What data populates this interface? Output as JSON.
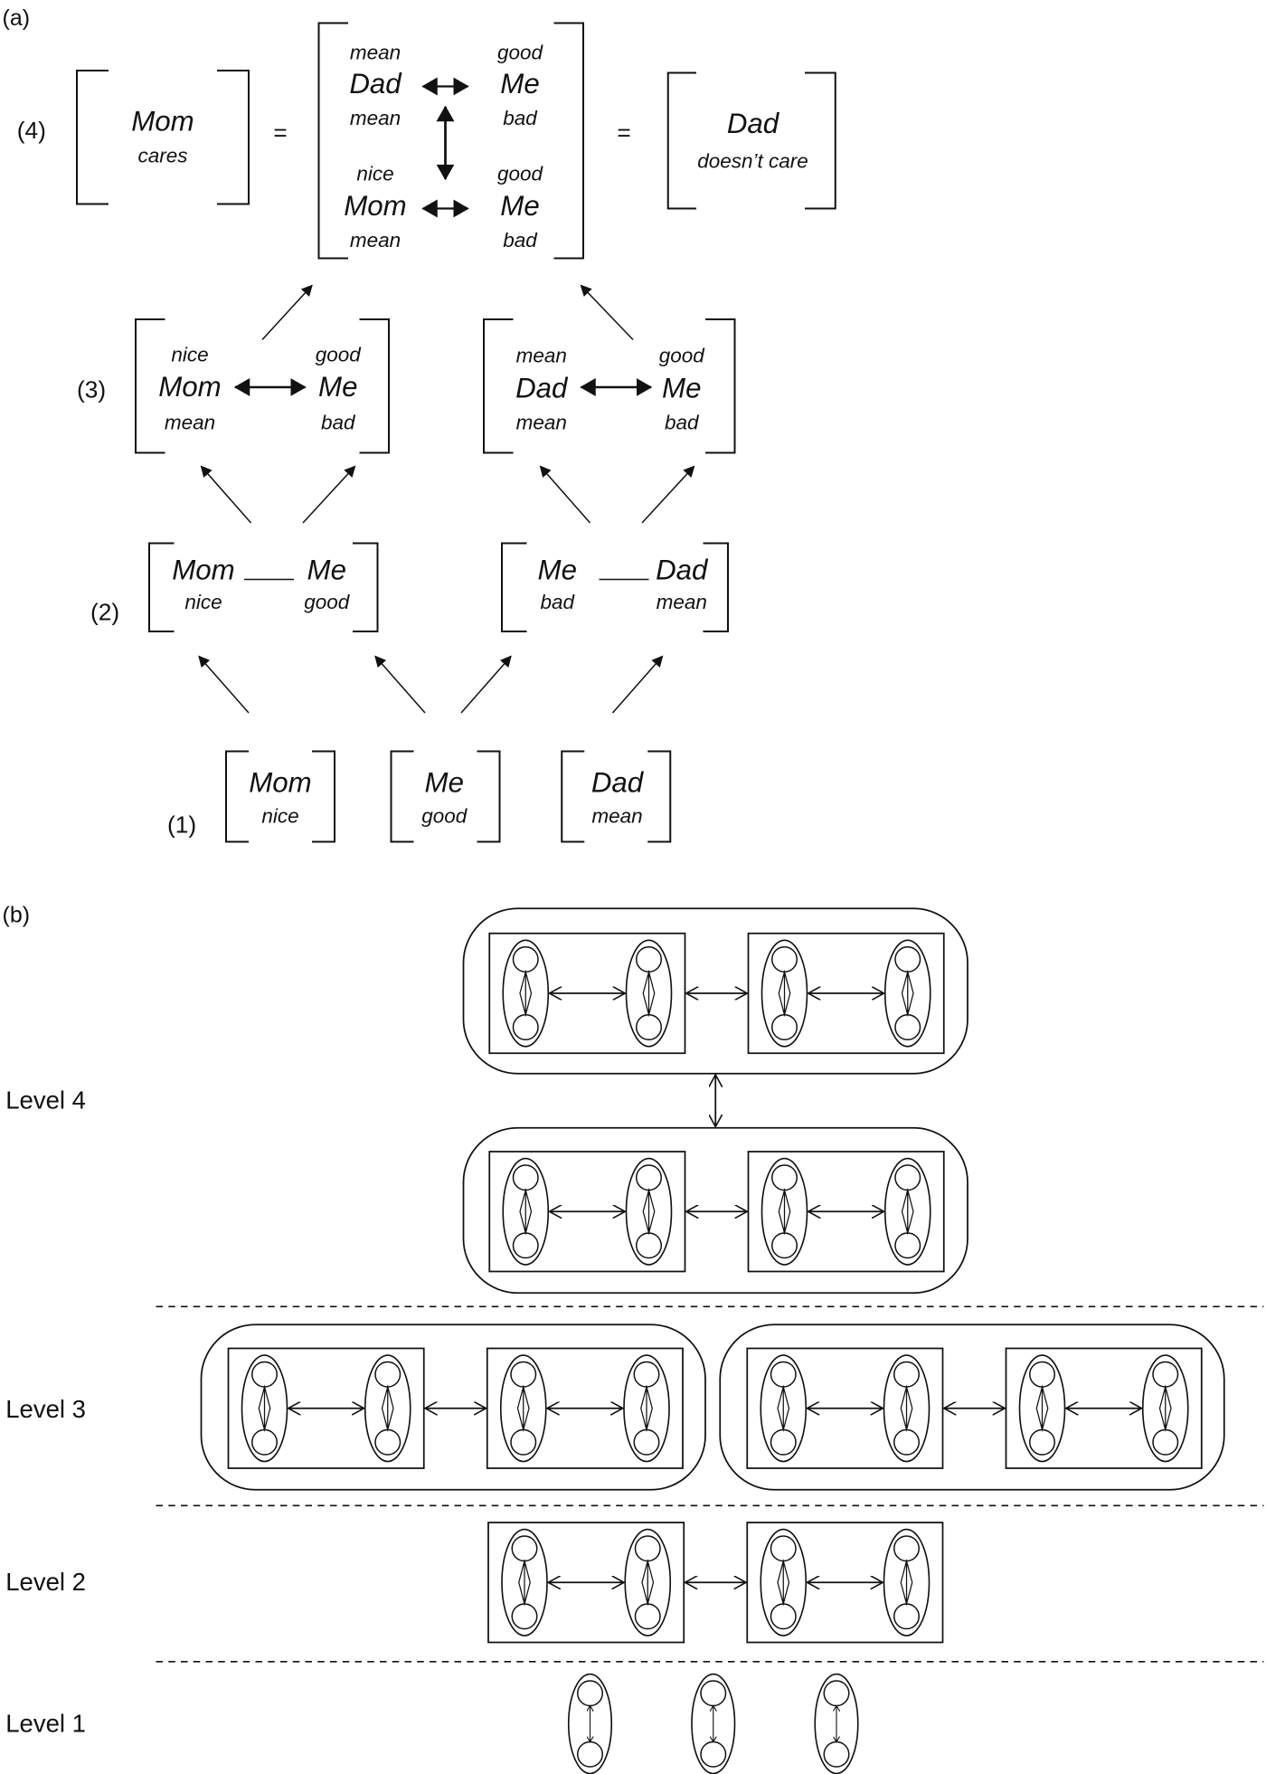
{
  "panel_a": {
    "label": "(a)",
    "levels": [
      {
        "label": "(4)",
        "left": {
          "main": "Mom",
          "sub": "cares"
        },
        "equals": "=",
        "center": {
          "top": {
            "left_top": "mean",
            "left_main": "Dad",
            "left_bottom": "mean",
            "right_top": "good",
            "right_main": "Me",
            "right_bottom": "bad"
          },
          "bottom": {
            "left_top": "nice",
            "left_main": "Mom",
            "left_bottom": "mean",
            "right_top": "good",
            "right_main": "Me",
            "right_bottom": "bad"
          }
        },
        "right": {
          "main": "Dad",
          "sub": "doesn’t care"
        }
      },
      {
        "label": "(3)",
        "groups": [
          {
            "left_top": "nice",
            "left_main": "Mom",
            "left_bottom": "mean",
            "right_top": "good",
            "right_main": "Me",
            "right_bottom": "bad"
          },
          {
            "left_top": "mean",
            "left_main": "Dad",
            "left_bottom": "mean",
            "right_top": "good",
            "right_main": "Me",
            "right_bottom": "bad"
          }
        ]
      },
      {
        "label": "(2)",
        "groups": [
          {
            "left_main": "Mom",
            "left_sub": "nice",
            "right_main": "Me",
            "right_sub": "good"
          },
          {
            "left_main": "Me",
            "left_sub": "bad",
            "right_main": "Dad",
            "right_sub": "mean"
          }
        ]
      },
      {
        "label": "(1)",
        "items": [
          {
            "main": "Mom",
            "sub": "nice"
          },
          {
            "main": "Me",
            "sub": "good"
          },
          {
            "main": "Dad",
            "sub": "mean"
          }
        ]
      }
    ]
  },
  "panel_b": {
    "label": "(b)",
    "levels": [
      "Level 4",
      "Level 3",
      "Level 2",
      "Level 1"
    ]
  }
}
